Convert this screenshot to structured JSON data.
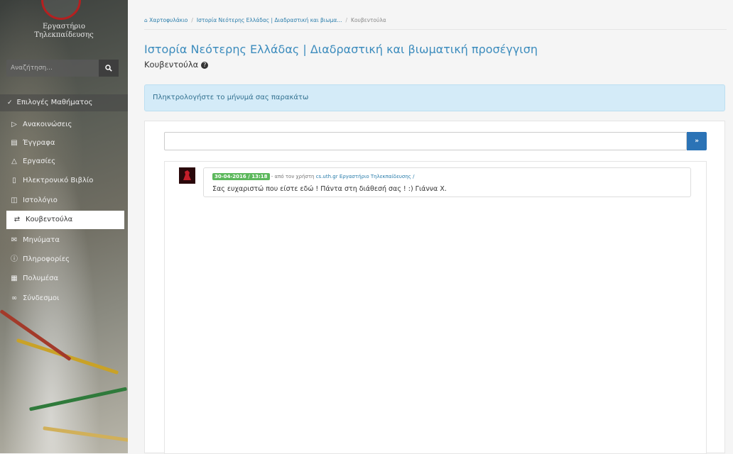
{
  "sidebar": {
    "logo_line1": "Εργαστήριο",
    "logo_line2": "Τηλεκπαίδευσης",
    "search_placeholder": "Αναζήτηση...",
    "course_menu_label": "Επιλογές Μαθήματος",
    "items": [
      {
        "label": "Ανακοινώσεις",
        "icon": "bullhorn-icon"
      },
      {
        "label": "Έγγραφα",
        "icon": "folder-icon"
      },
      {
        "label": "Εργασίες",
        "icon": "flask-icon"
      },
      {
        "label": "Ηλεκτρονικό Βιβλίο",
        "icon": "book-icon"
      },
      {
        "label": "Ιστολόγιο",
        "icon": "columns-icon"
      },
      {
        "label": "Κουβεντούλα",
        "icon": "exchange-icon",
        "active": true
      },
      {
        "label": "Μηνύματα",
        "icon": "envelope-icon"
      },
      {
        "label": "Πληροφορίες",
        "icon": "info-icon"
      },
      {
        "label": "Πολυμέσα",
        "icon": "film-icon"
      },
      {
        "label": "Σύνδεσμοι",
        "icon": "link-icon"
      }
    ]
  },
  "breadcrumb": {
    "home": "Χαρτοφυλάκιο",
    "course": "Ιστορία Νεότερης Ελλάδας | Διαδραστική και βιωμα...",
    "current": "Κουβεντούλα"
  },
  "course_title": "Ιστορία Νεότερης Ελλάδας | Διαδραστική και βιωματική προσέγγιση",
  "page_subtitle": "Κουβεντούλα",
  "alert_text": "Πληκτρολογήστε το μήνυμά σας παρακάτω",
  "chat": {
    "input_value": "",
    "send_label": "»",
    "messages": [
      {
        "timestamp": "30-04-2016 / 13:18",
        "prefix": "- από τον χρήστη",
        "user": "cs.uth.gr Εργαστήριο Τηλεκπαίδευσης /",
        "text": "Σας ευχαριστώ που είστε εδώ ! Πάντα στη διάθεσή σας ! :) Γιάννα Χ."
      }
    ]
  },
  "colors": {
    "accent": "#3c8cbd",
    "send_button": "#2b73b6",
    "timestamp_badge": "#5cb85c",
    "alert_bg": "#d4ebf8",
    "logo_red": "#b52020"
  }
}
